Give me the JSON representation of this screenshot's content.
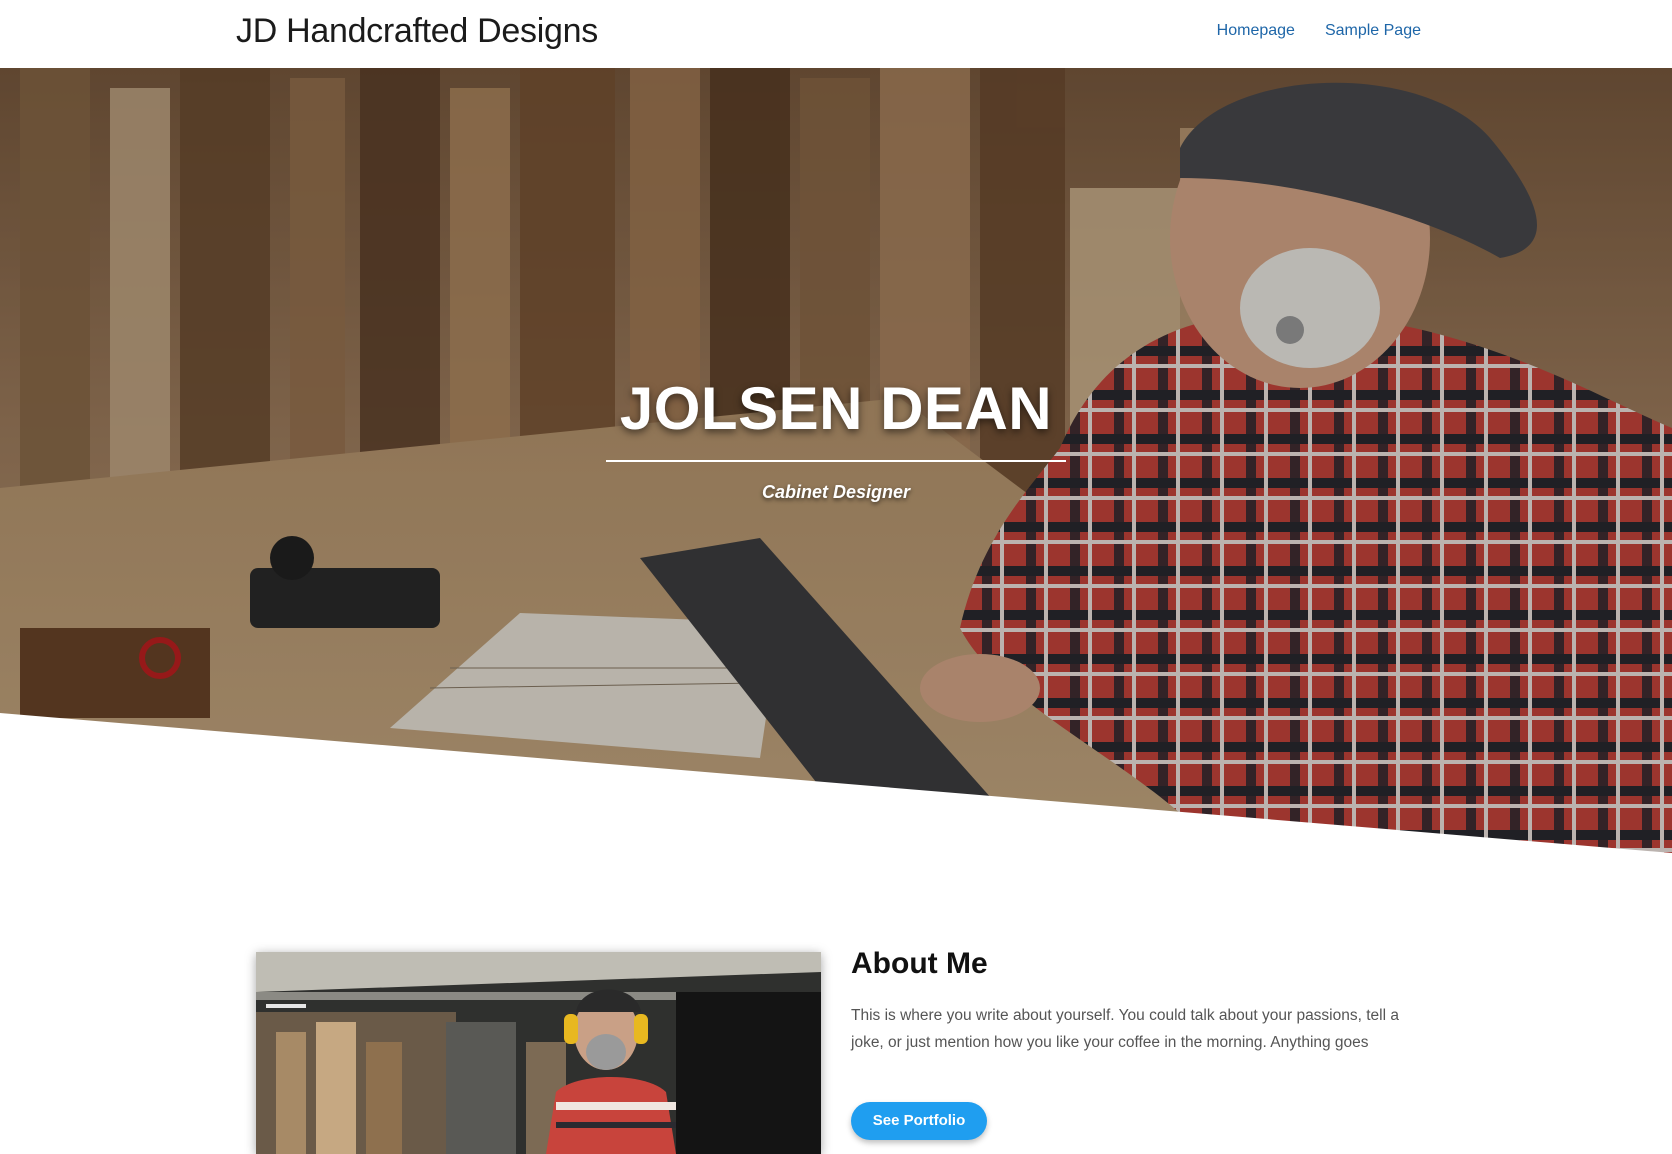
{
  "header": {
    "site_title": "JD Handcrafted Designs",
    "nav": [
      {
        "label": "Homepage"
      },
      {
        "label": "Sample Page"
      }
    ]
  },
  "hero": {
    "name": "JOLSEN DEAN",
    "role": "Cabinet Designer"
  },
  "about": {
    "title": "About Me",
    "text": "This is where you write about yourself. You could talk about your passions, tell a joke, or just mention how you like your coffee in the morning. Anything goes",
    "button_label": "See Portfolio"
  },
  "colors": {
    "nav_link": "#1e66a8",
    "button": "#1f9ef0",
    "title": "#1b1b1b"
  }
}
